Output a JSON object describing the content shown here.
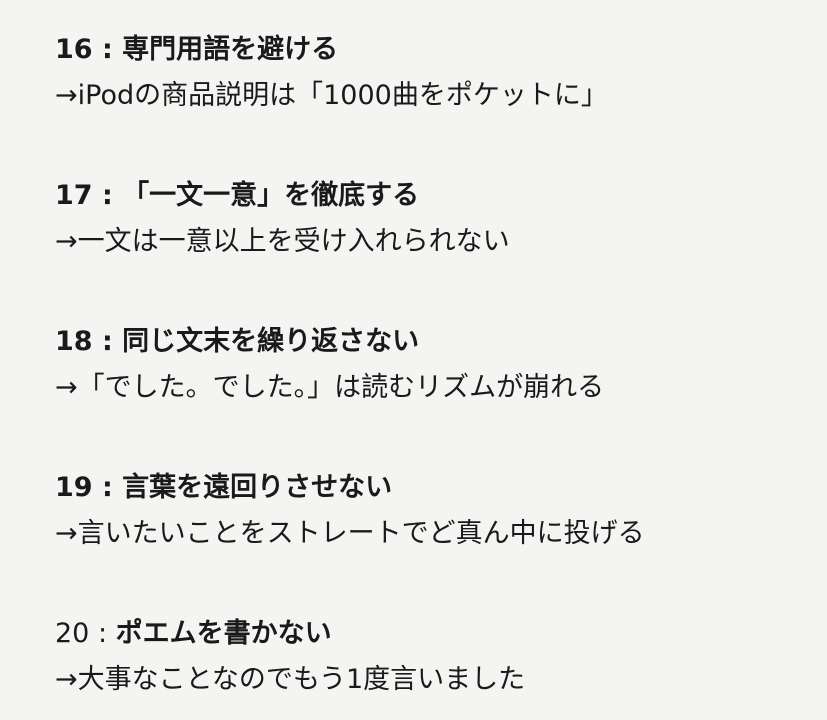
{
  "items": [
    {
      "number": "16 : ",
      "title": "専門用語を避ける",
      "description": "→iPodの商品説明は「1000曲をポケットに」"
    },
    {
      "number": "17 : ",
      "title": "「一文一意」を徹底する",
      "description": "→一文は一意以上を受け入れられない"
    },
    {
      "number": "18 : ",
      "title": "同じ文末を繰り返さない",
      "description": "→「でした。でした。」は読むリズムが崩れる"
    },
    {
      "number": "19 : ",
      "title": "言葉を遠回りさせない",
      "description": "→言いたいことをストレートでど真ん中に投げる"
    },
    {
      "number": "20 : ",
      "title": "ポエムを書かない",
      "description": "→大事なことなのでもう1度言いました"
    }
  ]
}
